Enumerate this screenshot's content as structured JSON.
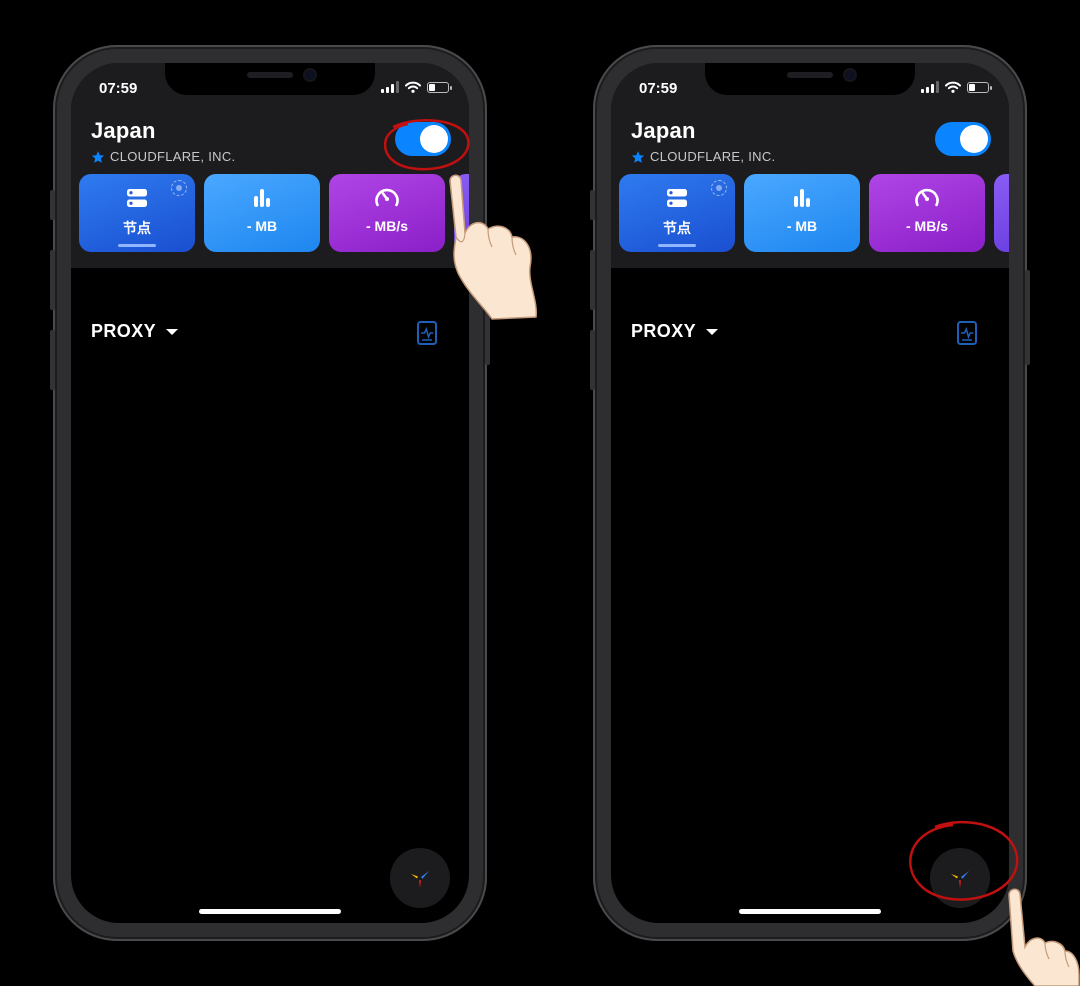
{
  "phones": [
    {
      "status": {
        "time": "07:59"
      },
      "header": {
        "title": "Japan",
        "subtitle": "CLOUDFLARE, INC."
      },
      "tiles": [
        {
          "label": "节点",
          "icon": "server-icon"
        },
        {
          "label": "- MB",
          "icon": "bar-chart-icon"
        },
        {
          "label": "- MB/s",
          "icon": "speedometer-icon"
        }
      ],
      "section": {
        "title": "PROXY"
      },
      "toggle_on": true
    },
    {
      "status": {
        "time": "07:59"
      },
      "header": {
        "title": "Japan",
        "subtitle": "CLOUDFLARE, INC."
      },
      "tiles": [
        {
          "label": "节点",
          "icon": "server-icon"
        },
        {
          "label": "- MB",
          "icon": "bar-chart-icon"
        },
        {
          "label": "- MB/s",
          "icon": "speedometer-icon"
        }
      ],
      "section": {
        "title": "PROXY"
      },
      "toggle_on": true
    }
  ],
  "colors": {
    "accent": "#0a84ff",
    "tile_nodes": "#2f7bf0",
    "tile_traffic": "#4aa8ff",
    "tile_speed": "#b045e6",
    "annotation": "#d01818"
  }
}
